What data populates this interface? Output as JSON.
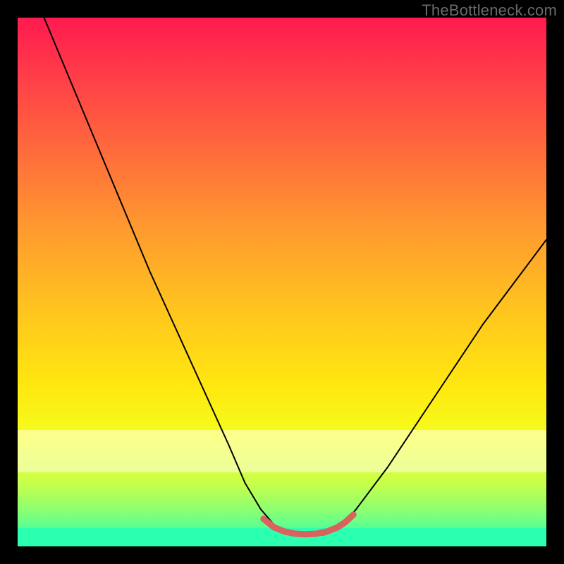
{
  "watermark": "TheBottleneck.com",
  "gradient": {
    "stops": [
      {
        "offset": 0.0,
        "color": "#ff1a4f"
      },
      {
        "offset": 0.1,
        "color": "#ff3a49"
      },
      {
        "offset": 0.25,
        "color": "#ff6a3c"
      },
      {
        "offset": 0.4,
        "color": "#ff9a2f"
      },
      {
        "offset": 0.55,
        "color": "#ffc41f"
      },
      {
        "offset": 0.7,
        "color": "#ffe80f"
      },
      {
        "offset": 0.8,
        "color": "#f3ff1f"
      },
      {
        "offset": 0.88,
        "color": "#c8ff4a"
      },
      {
        "offset": 0.93,
        "color": "#8eff70"
      },
      {
        "offset": 0.97,
        "color": "#4fff9a"
      },
      {
        "offset": 1.0,
        "color": "#1affc0"
      }
    ]
  },
  "green_band": {
    "y_top_frac": 0.965,
    "color": "#2bffb0"
  },
  "pale_band": {
    "y_top_frac": 0.78,
    "y_bot_frac": 0.86,
    "color": "rgba(255,255,230,0.55)"
  },
  "chart_data": {
    "type": "line",
    "title": "",
    "xlabel": "",
    "ylabel": "",
    "xlim": [
      0,
      100
    ],
    "ylim": [
      0,
      100
    ],
    "series": [
      {
        "name": "bottleneck-curve",
        "stroke": "#000000",
        "stroke_width": 2,
        "x": [
          5,
          10,
          15,
          20,
          25,
          30,
          35,
          40,
          43,
          46,
          49,
          52,
          55,
          58,
          61,
          64,
          70,
          76,
          82,
          88,
          94,
          100
        ],
        "y": [
          100,
          88,
          76,
          64,
          52,
          41,
          30,
          19,
          12,
          7,
          3.5,
          2.2,
          2.0,
          2.2,
          3.5,
          7,
          15,
          24,
          33,
          42,
          50,
          58
        ]
      },
      {
        "name": "highlight-segment",
        "stroke": "#d9625e",
        "stroke_width": 9,
        "x": [
          46.5,
          48.5,
          50.5,
          52.5,
          54.5,
          56.5,
          58.5,
          60.5,
          62.0,
          63.5
        ],
        "y": [
          5.2,
          3.6,
          2.8,
          2.4,
          2.3,
          2.4,
          2.8,
          3.6,
          4.6,
          6.0
        ]
      }
    ]
  }
}
